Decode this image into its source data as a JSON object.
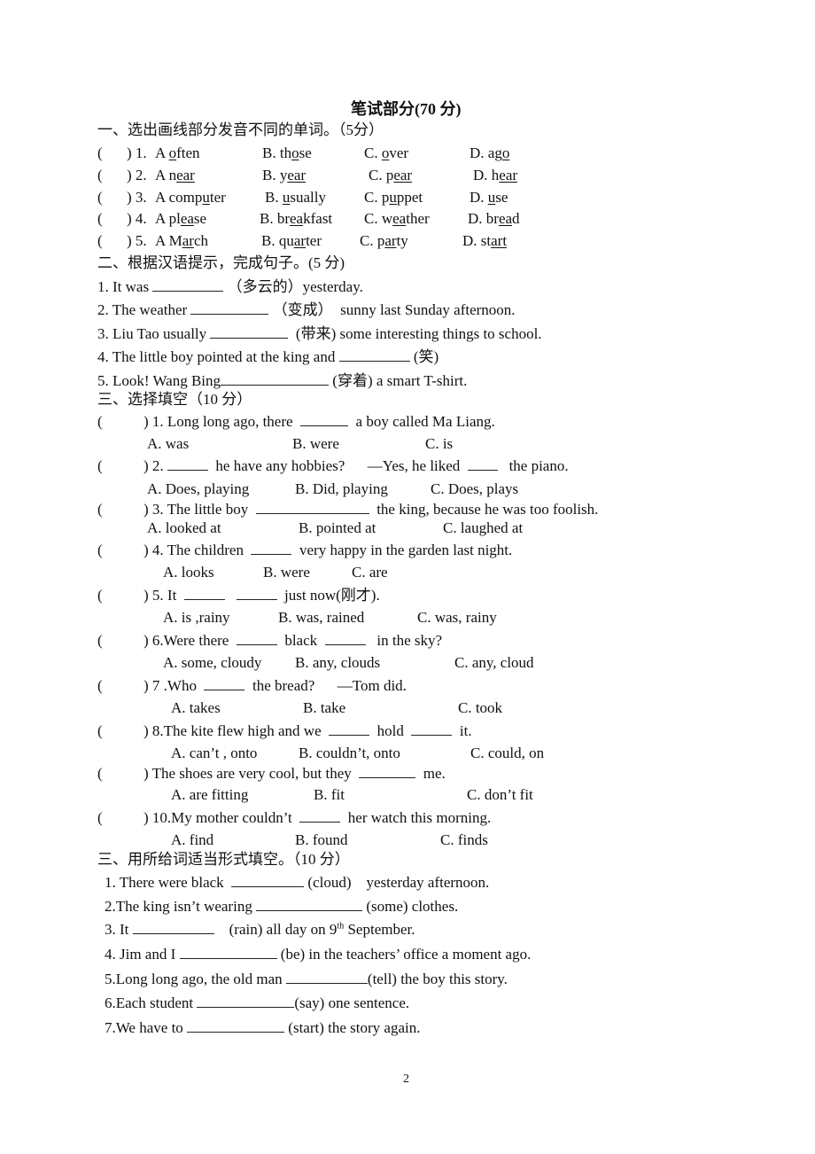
{
  "title": "笔试部分(70 分)",
  "section1": {
    "heading": "一、选出画线部分发音不同的单词。（5分）",
    "items": [
      {
        "num": "1.",
        "options": [
          {
            "letter": "A",
            "pre": "",
            "u": "o",
            "post": "ften"
          },
          {
            "letter": "B.",
            "pre": "th",
            "u": "o",
            "post": "se"
          },
          {
            "letter": "C.",
            "pre": "",
            "u": "o",
            "post": "ver"
          },
          {
            "letter": "D.",
            "pre": "ag",
            "u": "o",
            "post": ""
          }
        ]
      },
      {
        "num": "2.",
        "options": [
          {
            "letter": "A",
            "pre": "n",
            "u": "ear",
            "post": ""
          },
          {
            "letter": "B.",
            "pre": "y",
            "u": "ear",
            "post": ""
          },
          {
            "letter": "C.",
            "pre": "p",
            "u": "ear",
            "post": ""
          },
          {
            "letter": "D.",
            "pre": "h",
            "u": "ear",
            "post": ""
          }
        ]
      },
      {
        "num": "3.",
        "options": [
          {
            "letter": "A",
            "pre": "comp",
            "u": "u",
            "post": "ter"
          },
          {
            "letter": "B.",
            "pre": "",
            "u": "u",
            "post": "sually"
          },
          {
            "letter": "C.",
            "pre": "p",
            "u": "u",
            "post": "ppet"
          },
          {
            "letter": "D.",
            "pre": "",
            "u": "u",
            "post": "se"
          }
        ]
      },
      {
        "num": "4.",
        "options": [
          {
            "letter": "A",
            "pre": "pl",
            "u": "ea",
            "post": "se"
          },
          {
            "letter": "B.",
            "pre": "br",
            "u": "ea",
            "post": "kfast"
          },
          {
            "letter": "C.",
            "pre": "w",
            "u": "ea",
            "post": "ther"
          },
          {
            "letter": "D.",
            "pre": "br",
            "u": "ea",
            "post": "d"
          }
        ]
      },
      {
        "num": "5.",
        "options": [
          {
            "letter": "A",
            "pre": "M",
            "u": "ar",
            "post": "ch"
          },
          {
            "letter": "B.",
            "pre": "qu",
            "u": "ar",
            "post": "ter"
          },
          {
            "letter": "C.",
            "pre": "p",
            "u": "ar",
            "post": "ty"
          },
          {
            "letter": "D.",
            "pre": "st",
            "u": "art",
            "post": ""
          }
        ]
      }
    ]
  },
  "section2": {
    "heading": "二、根据汉语提示，完成句子。(5 分)",
    "items": [
      {
        "before": "1. It was ",
        "hint": "（多云的）",
        "after": "yesterday."
      },
      {
        "before": "2. The weather ",
        "hint": "（变成）",
        "after": "  sunny last Sunday afternoon."
      },
      {
        "before": "3. Liu Tao usually ",
        "hint": " (带来)",
        "after": " some interesting things to school."
      },
      {
        "before": "4. The little boy pointed at the king and ",
        "hint": "(笑)",
        "after": ""
      },
      {
        "before": "5. Look! Wang Bing",
        "hint": "(穿着)",
        "after": " a smart T-shirt."
      }
    ]
  },
  "section3": {
    "heading": "三、选择填空（10 分）",
    "items": [
      {
        "q": [
          ") 1. Long long ago, there ",
          " a boy called Ma Liang."
        ],
        "options": [
          "A. was",
          "B. were",
          "C. is"
        ]
      },
      {
        "q": [
          ") 2.",
          " he have any hobbies?      —Yes, he liked ",
          "  the piano."
        ],
        "options": [
          "A. Does, playing",
          "B. Did, playing",
          "C. Does, plays"
        ]
      },
      {
        "q": [
          ") 3. The little boy ",
          " the king, because he was too foolish."
        ],
        "options": [
          "A. looked at",
          "B. pointed at",
          "C. laughed at"
        ]
      },
      {
        "q": [
          ") 4. The children ",
          " very happy in the garden last night."
        ],
        "options": [
          "A. looks",
          "B. were",
          "C. are"
        ]
      },
      {
        "q": [
          ") 5. It ",
          " ",
          " just now(刚才)."
        ],
        "options": [
          "A. is ,rainy",
          "B. was, rained",
          "C. was, rainy"
        ]
      },
      {
        "q": [
          ") 6.Were there ",
          " black ",
          "  in the sky?"
        ],
        "options": [
          "A. some, cloudy",
          "B. any, clouds",
          "C. any, cloud"
        ]
      },
      {
        "q": [
          ") 7 .Who ",
          " the bread?      —Tom did."
        ],
        "options": [
          "A. takes",
          "B. take",
          "C. took"
        ]
      },
      {
        "q": [
          ") 8.The kite flew high and we ",
          " hold ",
          " it."
        ],
        "options": [
          "A. can’t , onto",
          "B. couldn’t, onto",
          "C. could, on"
        ]
      },
      {
        "q": [
          ") The shoes are very cool, but they ",
          " me."
        ],
        "options": [
          "A. are fitting",
          "B. fit",
          "C. don’t fit"
        ]
      },
      {
        "q": [
          ") 10.My mother couldn’t ",
          " her watch this morning."
        ],
        "options": [
          "A. find",
          "B. found",
          "C. finds"
        ]
      }
    ]
  },
  "section4": {
    "heading": "三、用所给词适当形式填空。（10 分）",
    "items": [
      {
        "before": "1. There were black  ",
        "after": " (cloud)    yesterday afternoon."
      },
      {
        "before": "2.The king isn’t wearing ",
        "after": " (some) clothes."
      },
      {
        "before": "3. It ",
        "after": "    (rain) all day on 9",
        "sup": "th",
        "after2": " September."
      },
      {
        "before": "4. Jim and I ",
        "after": " (be) in the teachers’ office a moment ago."
      },
      {
        "before": "5.Long long ago, the old man ",
        "after": "(tell) the boy this story."
      },
      {
        "before": "6.Each student ",
        "after": "(say) one sentence."
      },
      {
        "before": "7.We have to ",
        "after": " (start) the story again."
      }
    ]
  },
  "page_number": "2"
}
